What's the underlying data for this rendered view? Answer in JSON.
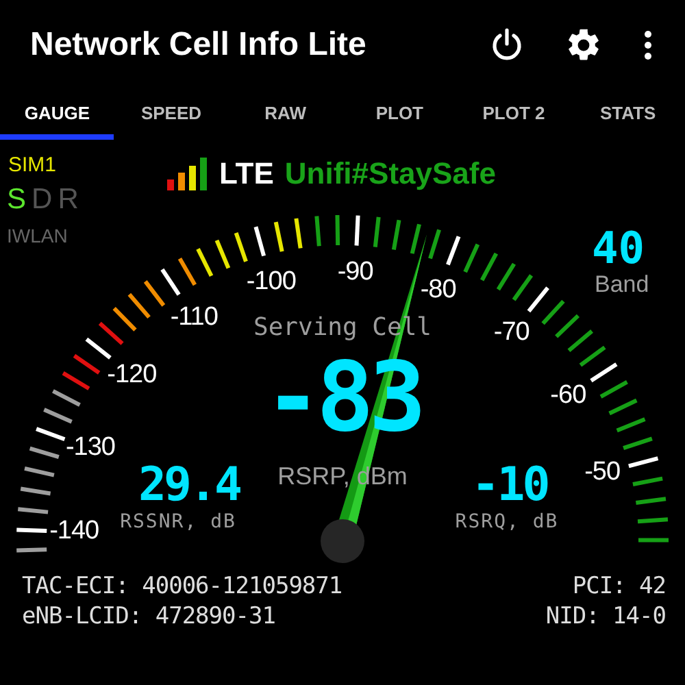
{
  "app_bar": {
    "title": "Network Cell Info Lite"
  },
  "tabs": [
    {
      "label": "GAUGE",
      "selected": true
    },
    {
      "label": "SPEED",
      "selected": false
    },
    {
      "label": "RAW",
      "selected": false
    },
    {
      "label": "PLOT",
      "selected": false
    },
    {
      "label": "PLOT 2",
      "selected": false
    },
    {
      "label": "STATS",
      "selected": false
    }
  ],
  "sim": {
    "label": "SIM1",
    "modes": [
      {
        "label": "S",
        "on": true
      },
      {
        "label": "D",
        "on": false
      },
      {
        "label": "R",
        "on": false
      }
    ],
    "iwlan": "IWLAN"
  },
  "network": {
    "type": "LTE",
    "operator": "Unifi#StaySafe"
  },
  "band": {
    "value": "40",
    "label": "Band"
  },
  "gauge": {
    "scale_labels": [
      "-140",
      "-130",
      "-120",
      "-110",
      "-100",
      "-90",
      "-80",
      "-70",
      "-60",
      "-50"
    ],
    "title": "Serving Cell",
    "rsrp": {
      "value": "-83",
      "label": "RSRP, dBm"
    },
    "rssnr": {
      "value": "29.4",
      "label": "RSSNR, dB"
    },
    "rsrq": {
      "value": "-10",
      "label": "RSRQ, dB"
    }
  },
  "info": [
    {
      "left": "TAC-ECI: 40006-121059871",
      "right": "PCI: 42"
    },
    {
      "left": "eNB-LCID: 472890-31",
      "right": "NID: 14-0"
    }
  ]
}
